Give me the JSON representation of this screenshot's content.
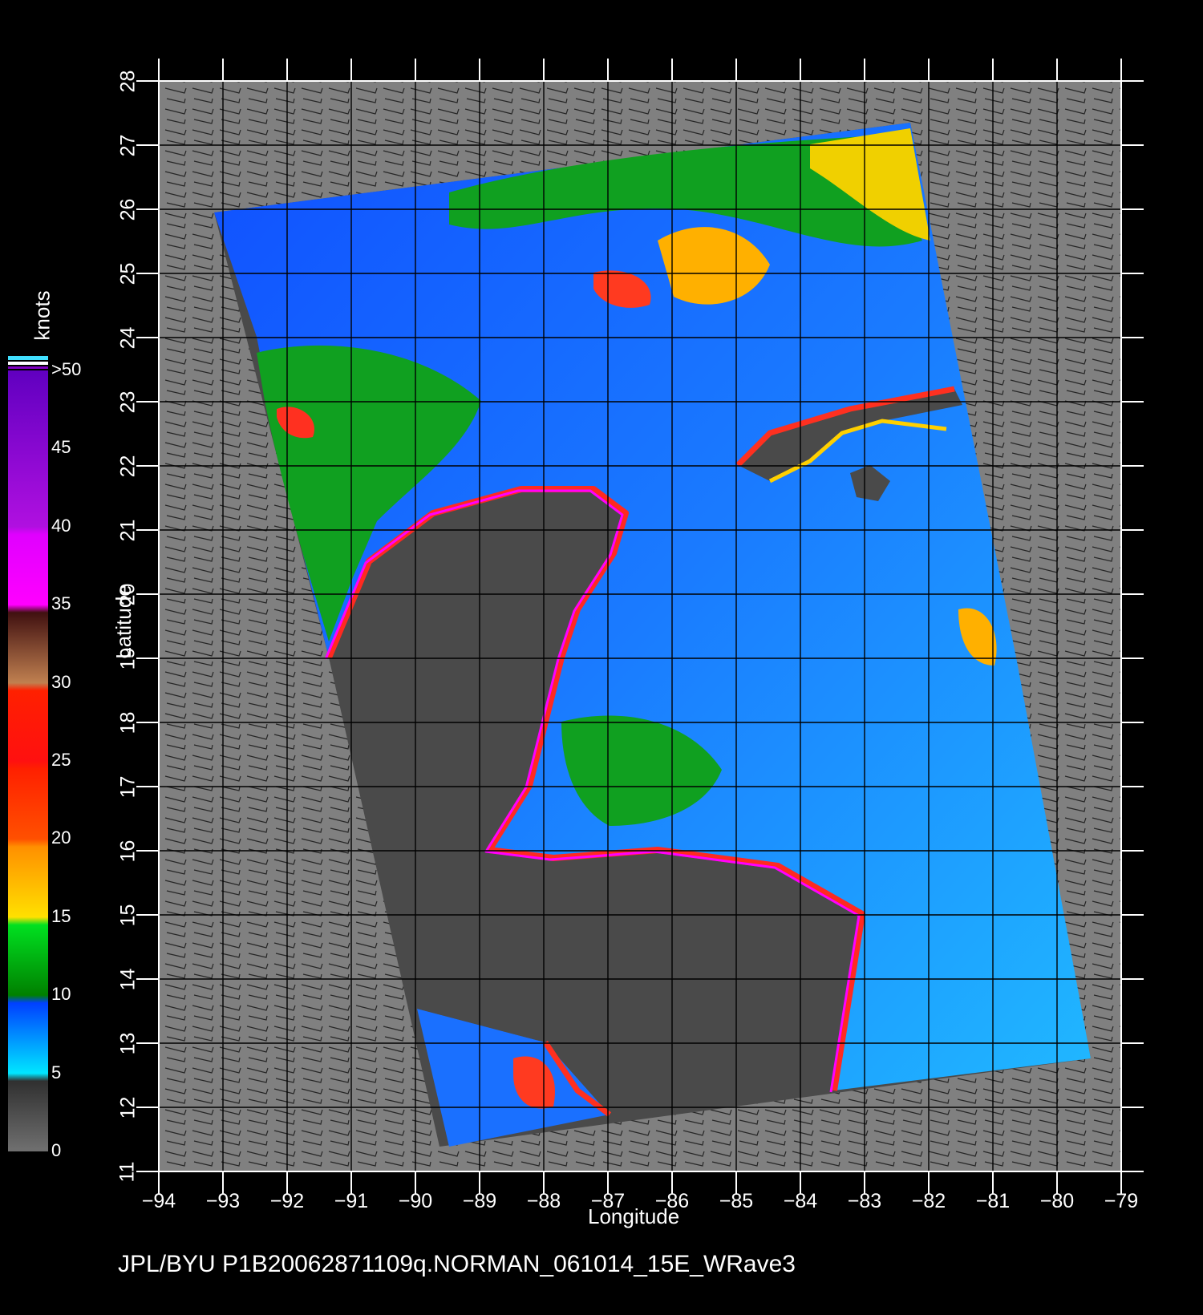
{
  "map": {
    "xlabel": "Longitude",
    "ylabel": "Latitude",
    "lon_range": [
      -94,
      -79
    ],
    "lat_range": [
      11,
      28
    ],
    "lon_ticks": [
      "−94",
      "−93",
      "−92",
      "−91",
      "−90",
      "−89",
      "−88",
      "−87",
      "−86",
      "−85",
      "−84",
      "−83",
      "−82",
      "−81",
      "−80",
      "−79"
    ],
    "lat_ticks": [
      "11",
      "12",
      "13",
      "14",
      "15",
      "16",
      "17",
      "18",
      "19",
      "20",
      "21",
      "22",
      "23",
      "24",
      "25",
      "26",
      "27",
      "28"
    ],
    "grid": true,
    "colors": {
      "background": "#000000",
      "no_data": "#808080",
      "land": "#4a4a4a",
      "grid": "#000000",
      "axes": "#ffffff"
    }
  },
  "colorbar": {
    "title": "knots",
    "ticks": [
      "0",
      "5",
      "10",
      "15",
      "20",
      "25",
      "30",
      "35",
      "40",
      "45",
      ">50"
    ],
    "colors": [
      "#707070",
      "#00e6ff",
      "#0040ff",
      "#00a000",
      "#ffd000",
      "#ff6000",
      "#ff1a1a",
      "#804020",
      "#ff00ff",
      "#8000c0"
    ]
  },
  "footer": {
    "text": "JPL/BYU  P1B20062871109q.NORMAN_061014_15E_WRave3"
  }
}
